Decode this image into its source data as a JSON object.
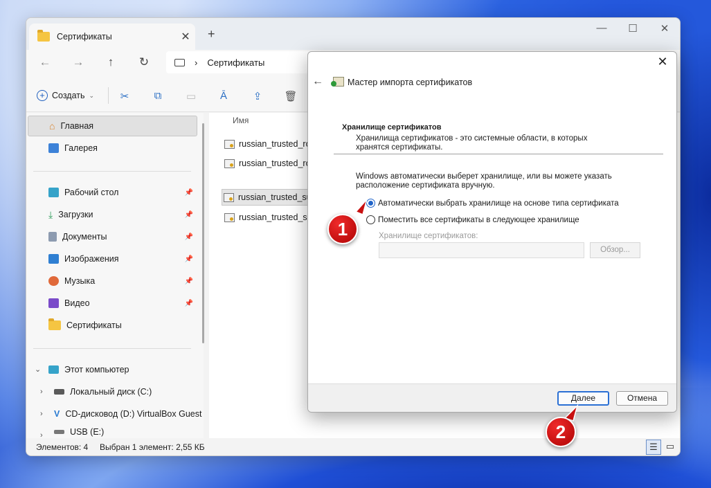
{
  "explorer": {
    "tab_title": "Сертификаты",
    "address_path": "Сертификаты",
    "toolbar": {
      "create_label": "Создать"
    },
    "sidebar": {
      "quick": [
        {
          "label": "Главная",
          "icon": "home-icon",
          "selected": true
        },
        {
          "label": "Галерея",
          "icon": "gallery-icon"
        }
      ],
      "pinned": [
        {
          "label": "Рабочий стол",
          "icon": "desktop-icon"
        },
        {
          "label": "Загрузки",
          "icon": "download-icon"
        },
        {
          "label": "Документы",
          "icon": "documents-icon"
        },
        {
          "label": "Изображения",
          "icon": "pictures-icon"
        },
        {
          "label": "Музыка",
          "icon": "music-icon"
        },
        {
          "label": "Видео",
          "icon": "video-icon"
        },
        {
          "label": "Сертификаты",
          "icon": "folder-icon"
        }
      ],
      "this_pc": "Этот компьютер",
      "drives": [
        {
          "label": "Локальный диск (C:)"
        },
        {
          "label": "CD-дисковод (D:) VirtualBox Guest"
        },
        {
          "label": "USB (E:)"
        }
      ]
    },
    "filelist": {
      "column_name": "Имя",
      "files": [
        {
          "name": "russian_trusted_roo"
        },
        {
          "name": "russian_trusted_roo"
        },
        {
          "name": "russian_trusted_sub",
          "selected": true
        },
        {
          "name": "russian_trusted_sub"
        }
      ]
    },
    "status": {
      "count": "Элементов: 4",
      "selection": "Выбран 1 элемент: 2,55 КБ"
    }
  },
  "dialog": {
    "title": "Мастер импорта сертификатов",
    "section_header": "Хранилище сертификатов",
    "section_desc": "Хранилища сертификатов - это системные области, в которых хранятся сертификаты.",
    "info": "Windows автоматически выберет хранилище, или вы можете указать расположение сертификата вручную.",
    "option_auto": "Автоматически выбрать хранилище на основе типа сертификата",
    "option_manual": "Поместить все сертификаты в следующее хранилище",
    "store_label": "Хранилище сертификатов:",
    "store_value": "",
    "browse_label": "Обзор...",
    "next_label": "Далее",
    "cancel_label": "Отмена"
  },
  "badges": {
    "one": "1",
    "two": "2"
  },
  "colors": {
    "accent": "#1f63c9",
    "badge": "#d01515"
  }
}
